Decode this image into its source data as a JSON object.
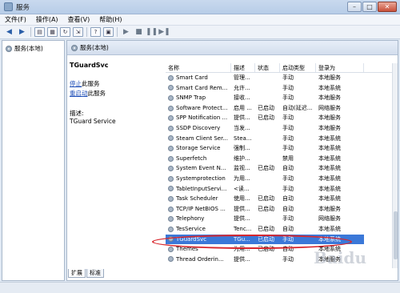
{
  "window": {
    "title": "服务"
  },
  "menu": [
    "文件(F)",
    "操作(A)",
    "查看(V)",
    "帮助(H)"
  ],
  "tree": {
    "root_label": "服务(本地)"
  },
  "panel": {
    "header": "服务(本地)"
  },
  "details": {
    "service_name": "TGuardSvc",
    "stop_link": "停止",
    "stop_suffix": "此服务",
    "restart_link": "重启动",
    "restart_suffix": "此服务",
    "desc_label": "描述:",
    "desc_text": "TGuard Service"
  },
  "columns": [
    "名称",
    "描述",
    "状态",
    "启动类型",
    "登录为"
  ],
  "rows": [
    {
      "name": "Smart Card",
      "desc": "管理...",
      "status": "",
      "startup": "手动",
      "logon": "本地服务"
    },
    {
      "name": "Smart Card Rem...",
      "desc": "允许...",
      "status": "",
      "startup": "手动",
      "logon": "本地系统"
    },
    {
      "name": "SNMP Trap",
      "desc": "接收...",
      "status": "",
      "startup": "手动",
      "logon": "本地服务"
    },
    {
      "name": "Software Protect...",
      "desc": "启用 ...",
      "status": "已启动",
      "startup": "自动(延迟...",
      "logon": "网络服务"
    },
    {
      "name": "SPP Notification ...",
      "desc": "提供...",
      "status": "已启动",
      "startup": "手动",
      "logon": "本地服务"
    },
    {
      "name": "SSDP Discovery",
      "desc": "当发...",
      "status": "",
      "startup": "手动",
      "logon": "本地服务"
    },
    {
      "name": "Steam Client Ser...",
      "desc": "Stea...",
      "status": "",
      "startup": "手动",
      "logon": "本地系统"
    },
    {
      "name": "Storage Service",
      "desc": "强制...",
      "status": "",
      "startup": "手动",
      "logon": "本地系统"
    },
    {
      "name": "Superfetch",
      "desc": "维护...",
      "status": "",
      "startup": "禁用",
      "logon": "本地系统"
    },
    {
      "name": "System Event N...",
      "desc": "监视...",
      "status": "已启动",
      "startup": "自动",
      "logon": "本地系统"
    },
    {
      "name": "Systemprotection",
      "desc": "为用...",
      "status": "",
      "startup": "手动",
      "logon": "本地系统"
    },
    {
      "name": "TabletInputServi...",
      "desc": "<读...",
      "status": "",
      "startup": "手动",
      "logon": "本地系统"
    },
    {
      "name": "Task Scheduler",
      "desc": "使用...",
      "status": "已启动",
      "startup": "自动",
      "logon": "本地系统"
    },
    {
      "name": "TCP/IP NetBIOS ...",
      "desc": "提供...",
      "status": "已启动",
      "startup": "自动",
      "logon": "本地服务"
    },
    {
      "name": "Telephony",
      "desc": "提供...",
      "status": "",
      "startup": "手动",
      "logon": "网络服务"
    },
    {
      "name": "TesService",
      "desc": "Tenc...",
      "status": "已启动",
      "startup": "自动",
      "logon": "本地系统"
    },
    {
      "name": "TGuardSvc",
      "desc": "TGu...",
      "status": "已启动",
      "startup": "手动",
      "logon": "本地系统"
    },
    {
      "name": "Themes",
      "desc": "为用...",
      "status": "已启动",
      "startup": "自动",
      "logon": "本地系统"
    },
    {
      "name": "Thread Orderin...",
      "desc": "提供...",
      "status": "",
      "startup": "手动",
      "logon": "本地服务"
    }
  ],
  "selected_index": 16,
  "tabs": [
    "扩展",
    "标准"
  ],
  "watermark": "Baidu"
}
